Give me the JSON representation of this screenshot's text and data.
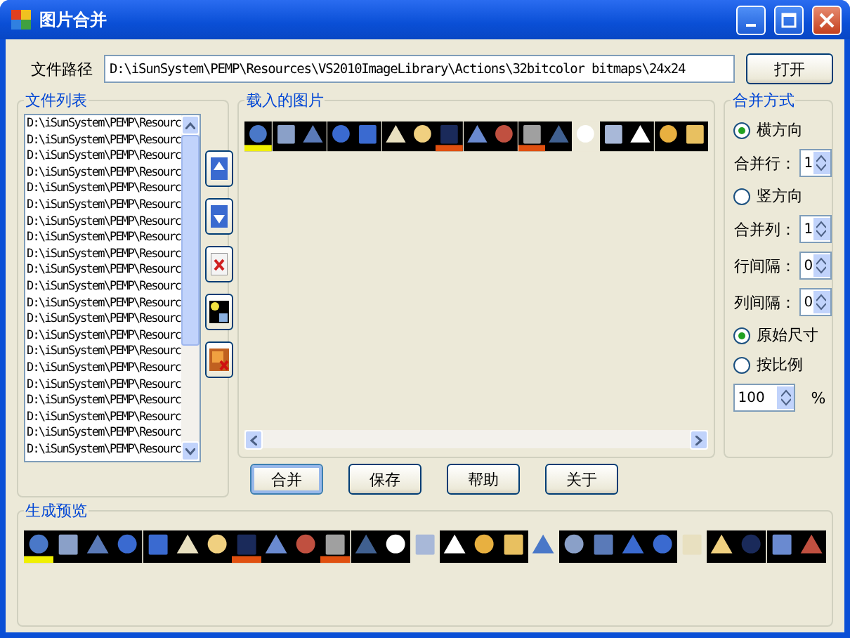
{
  "window": {
    "title": "图片合并"
  },
  "path": {
    "label": "文件路径",
    "value": "D:\\iSunSystem\\PEMP\\Resources\\VS2010ImageLibrary\\Actions\\32bitcolor bitmaps\\24x24",
    "button": "打开"
  },
  "file_list": {
    "title": "文件列表",
    "items": [
      "D:\\iSunSystem\\PEMP\\Resourc",
      "D:\\iSunSystem\\PEMP\\Resourc",
      "D:\\iSunSystem\\PEMP\\Resourc",
      "D:\\iSunSystem\\PEMP\\Resourc",
      "D:\\iSunSystem\\PEMP\\Resourc",
      "D:\\iSunSystem\\PEMP\\Resourc",
      "D:\\iSunSystem\\PEMP\\Resourc",
      "D:\\iSunSystem\\PEMP\\Resourc",
      "D:\\iSunSystem\\PEMP\\Resourc",
      "D:\\iSunSystem\\PEMP\\Resourc",
      "D:\\iSunSystem\\PEMP\\Resourc",
      "D:\\iSunSystem\\PEMP\\Resourc",
      "D:\\iSunSystem\\PEMP\\Resourc",
      "D:\\iSunSystem\\PEMP\\Resourc",
      "D:\\iSunSystem\\PEMP\\Resourc",
      "D:\\iSunSystem\\PEMP\\Resourc",
      "D:\\iSunSystem\\PEMP\\Resourc",
      "D:\\iSunSystem\\PEMP\\Resourc",
      "D:\\iSunSystem\\PEMP\\Resourc",
      "D:\\iSunSystem\\PEMP\\Resourc",
      "D:\\iSunSystem\\PEMP\\Resourc"
    ]
  },
  "loaded_images": {
    "title": "载入的图片"
  },
  "merge_mode": {
    "title": "合并方式",
    "controls": [
      {
        "kind": "radio",
        "label": "横方向",
        "selected": true
      },
      {
        "kind": "spinner",
        "label": "合并行：",
        "value": "1"
      },
      {
        "kind": "radio",
        "label": "竖方向",
        "selected": false
      },
      {
        "kind": "spinner",
        "label": "合并列：",
        "value": "1"
      },
      {
        "kind": "spinner",
        "label": "行间隔：",
        "value": "0"
      },
      {
        "kind": "spinner",
        "label": "列间隔：",
        "value": "0"
      },
      {
        "kind": "radio",
        "label": "原始尺寸",
        "selected": true
      },
      {
        "kind": "radio",
        "label": "按比例",
        "selected": false
      },
      {
        "kind": "percent",
        "value": "100",
        "unit": "%"
      }
    ]
  },
  "actions": [
    {
      "label": "合并",
      "focused": true
    },
    {
      "label": "保存",
      "focused": false
    },
    {
      "label": "帮助",
      "focused": false
    },
    {
      "label": "关于",
      "focused": false
    }
  ],
  "preview": {
    "title": "生成预览"
  }
}
